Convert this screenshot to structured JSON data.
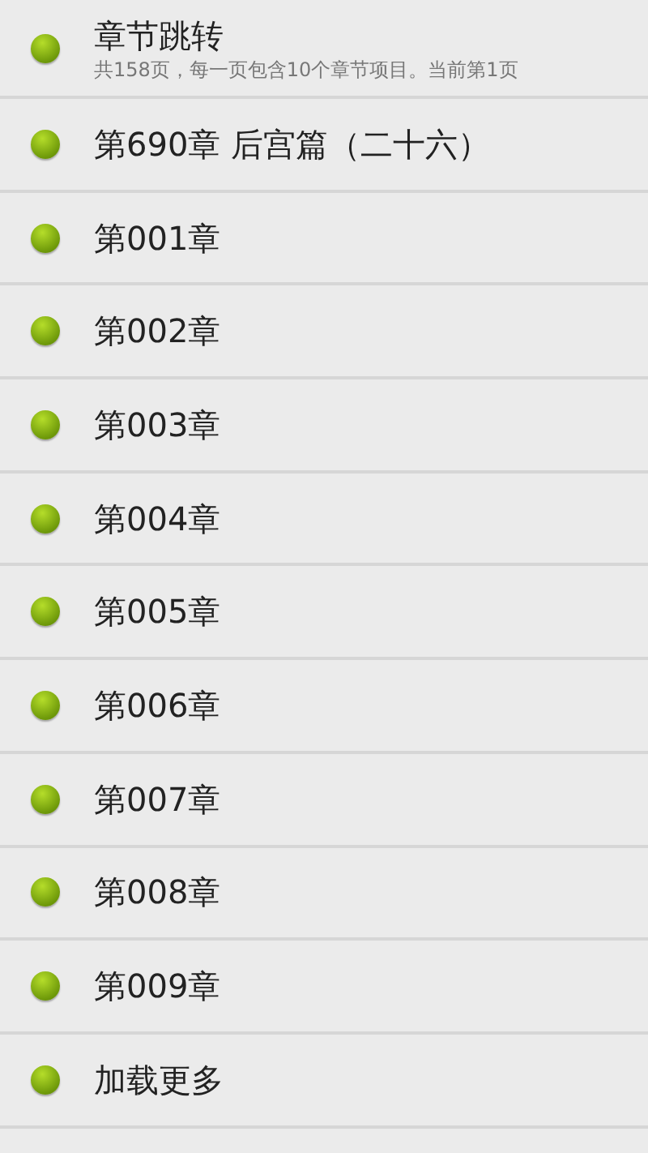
{
  "items": [
    {
      "title": "章节跳转",
      "subtitle": "共158页，每一页包含10个章节项目。当前第1页"
    },
    {
      "title": "第690章 后宫篇（二十六）"
    },
    {
      "title": "第001章"
    },
    {
      "title": "第002章"
    },
    {
      "title": "第003章"
    },
    {
      "title": "第004章"
    },
    {
      "title": "第005章"
    },
    {
      "title": "第006章"
    },
    {
      "title": "第007章"
    },
    {
      "title": "第008章"
    },
    {
      "title": "第009章"
    },
    {
      "title": "加载更多"
    }
  ]
}
